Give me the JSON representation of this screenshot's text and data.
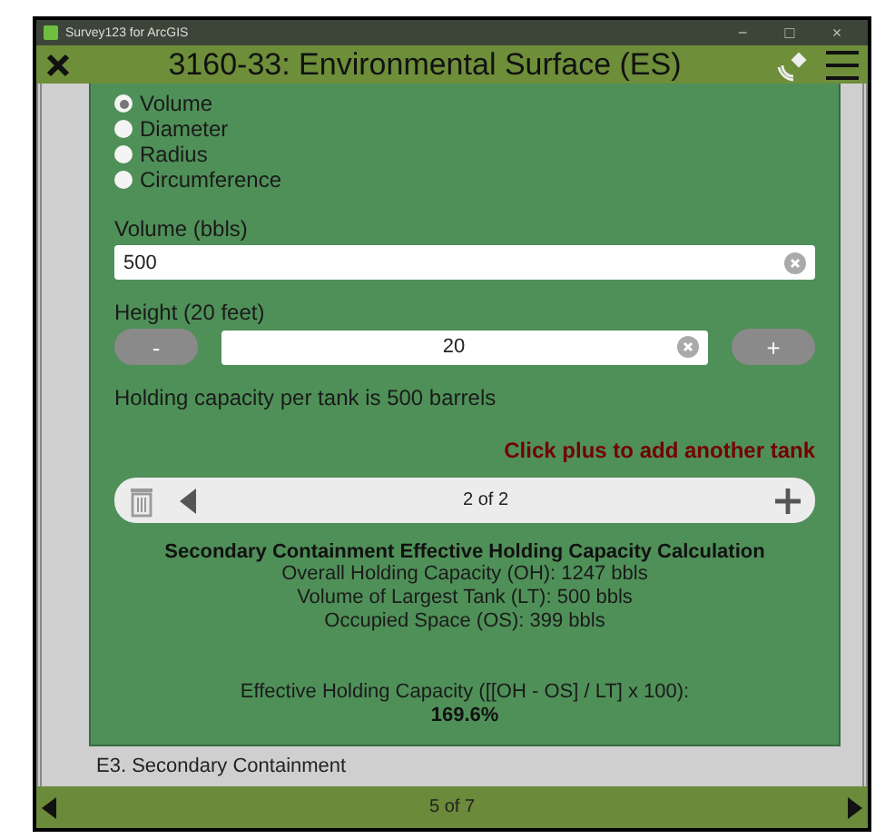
{
  "window": {
    "title": "Survey123 for ArcGIS",
    "controls": [
      "−",
      "□",
      "×"
    ]
  },
  "header": {
    "title": "3160-33: Environmental Surface (ES)"
  },
  "measure_options": [
    {
      "label": "Volume",
      "selected": true
    },
    {
      "label": "Diameter",
      "selected": false
    },
    {
      "label": "Radius",
      "selected": false
    },
    {
      "label": "Circumference",
      "selected": false
    }
  ],
  "volume_field": {
    "label": "Volume (bbls)",
    "value": "500"
  },
  "height_field": {
    "label": "Height (20 feet)",
    "value": "20",
    "minus": "-",
    "plus": "+"
  },
  "capacity_note": "Holding capacity per tank is 500 barrels",
  "add_hint": "Click plus to add another tank",
  "repeat_nav": {
    "position": "2 of 2"
  },
  "calculation": {
    "title": "Secondary Containment Effective Holding Capacity Calculation",
    "lines": [
      "Overall Holding Capacity (OH): 1247 bbls",
      "Volume of Largest Tank (LT): 500 bbls",
      "Occupied Space (OS): 399 bbls"
    ],
    "formula": "Effective Holding Capacity ([[OH - OS] / LT] x 100):",
    "result": "169.6%"
  },
  "next_section": "E3. Secondary Containment",
  "footer": {
    "page": "5 of 7"
  }
}
